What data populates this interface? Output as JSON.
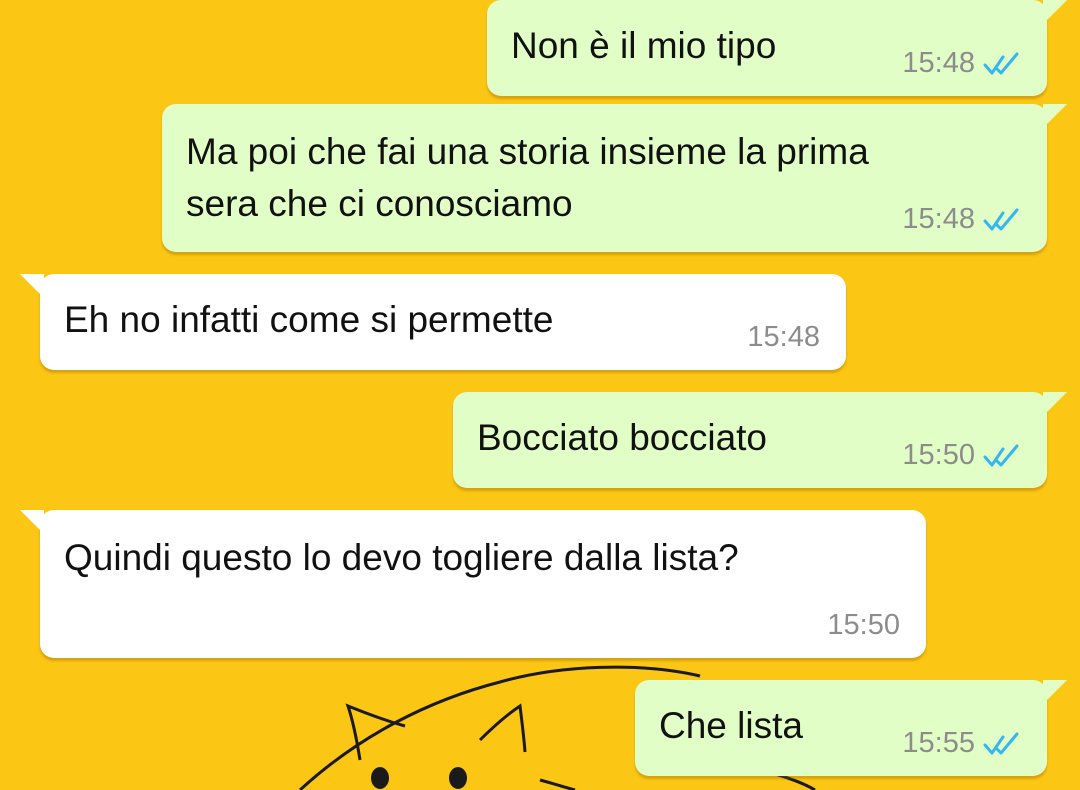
{
  "chat": {
    "messages": [
      {
        "direction": "outgoing",
        "text": "Non è il mio tipo",
        "time": "15:48",
        "status": "read"
      },
      {
        "direction": "outgoing",
        "text": "Ma poi che fai una storia insieme la prima\nsera che ci conosciamo",
        "time": "15:48",
        "status": "read"
      },
      {
        "direction": "incoming",
        "text": "Eh no infatti come si permette",
        "time": "15:48"
      },
      {
        "direction": "outgoing",
        "text": "Bocciato bocciato",
        "time": "15:50",
        "status": "read"
      },
      {
        "direction": "incoming",
        "text": "Quindi questo lo devo togliere dalla lista?",
        "time": "15:50"
      },
      {
        "direction": "outgoing",
        "text": "Che lista",
        "time": "15:55",
        "status": "read"
      }
    ]
  },
  "icons": {
    "read_receipt": "double-check-icon",
    "wallpaper": "cat-doodle-wallpaper"
  },
  "colors": {
    "background": "#FCC614",
    "outgoing_bubble": "#E1FEC6",
    "incoming_bubble": "#FFFFFF",
    "timestamp": "#8C8C8C",
    "read_ticks": "#34B7F1"
  }
}
